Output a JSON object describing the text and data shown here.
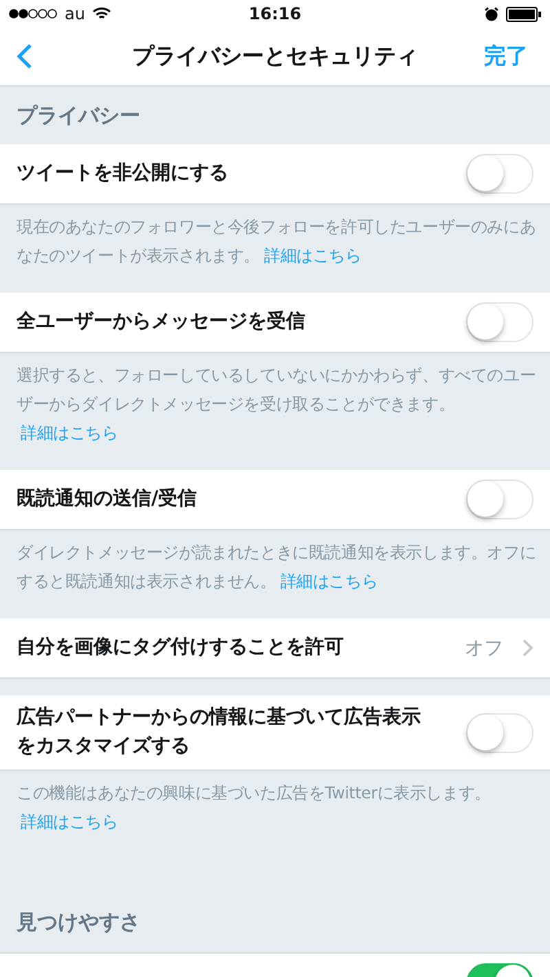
{
  "status_bar": {
    "carrier": "au",
    "time": "16:16"
  },
  "nav": {
    "title": "プライバシーとセキュリティ",
    "done": "完了"
  },
  "items": [
    {
      "kind": "header",
      "label": "プライバシー"
    },
    {
      "kind": "toggle",
      "label": "ツイートを非公開にする",
      "on": false,
      "description": {
        "text": "現在のあなたのフォロワーと今後フォローを許可したユーザーのみにあなたのツイートが表示されます。",
        "link": "詳細はこちら"
      }
    },
    {
      "kind": "toggle",
      "label": "全ユーザーからメッセージを受信",
      "on": false,
      "description": {
        "text": "選択すると、フォローしているしていないにかかわらず、すべてのユーザーからダイレクトメッセージを受け取ることができます。",
        "link": "詳細はこちら"
      }
    },
    {
      "kind": "toggle",
      "label": "既読通知の送信/受信",
      "on": false,
      "description": {
        "text": "ダイレクトメッセージが読まれたときに既読通知を表示します。オフにすると既読通知は表示されません。",
        "link": "詳細はこちら"
      }
    },
    {
      "kind": "value",
      "label": "自分を画像にタグ付けすることを許可",
      "value": "オフ"
    },
    {
      "kind": "toggle",
      "label": "広告パートナーからの情報に基づいて広告表示をカスタマイズする",
      "on": false,
      "description": {
        "text": "この機能はあなたの興味に基づいた広告をTwitterに表示します。",
        "link": "詳細はこちら"
      }
    },
    {
      "kind": "header",
      "label": "見つけやすさ"
    },
    {
      "kind": "toggle",
      "on": true
    }
  ]
}
